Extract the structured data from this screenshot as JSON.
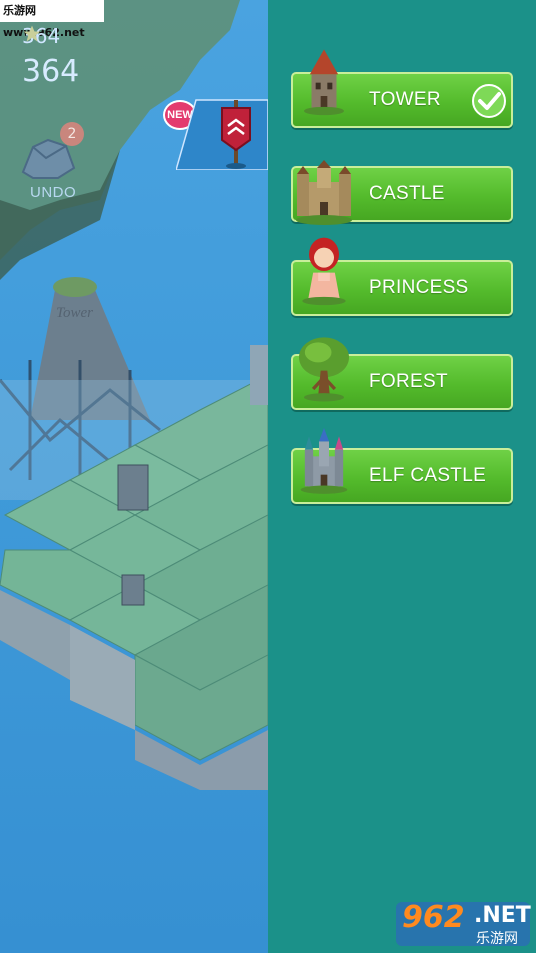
{
  "watermark_top": "乐游网 www.962.net",
  "hud": {
    "stars": "364",
    "score": "364",
    "undo_count": "2",
    "undo_label": "UNDO",
    "new_badge": "NEW"
  },
  "map_label": "Tower",
  "menu": {
    "items": [
      {
        "label": "TOWER",
        "icon": "tower-icon",
        "selected": true
      },
      {
        "label": "CASTLE",
        "icon": "castle-icon",
        "selected": false
      },
      {
        "label": "PRINCESS",
        "icon": "princess-icon",
        "selected": false
      },
      {
        "label": "FOREST",
        "icon": "tree-icon",
        "selected": false
      },
      {
        "label": "ELF CASTLE",
        "icon": "elf-castle-icon",
        "selected": false
      }
    ]
  },
  "watermark_logo": {
    "digits": "962",
    "suffix": ".NET",
    "cn": "乐游网"
  },
  "colors": {
    "panel": "#1b9189",
    "button": "#54bb2c",
    "sea": "#3f9ad9"
  }
}
